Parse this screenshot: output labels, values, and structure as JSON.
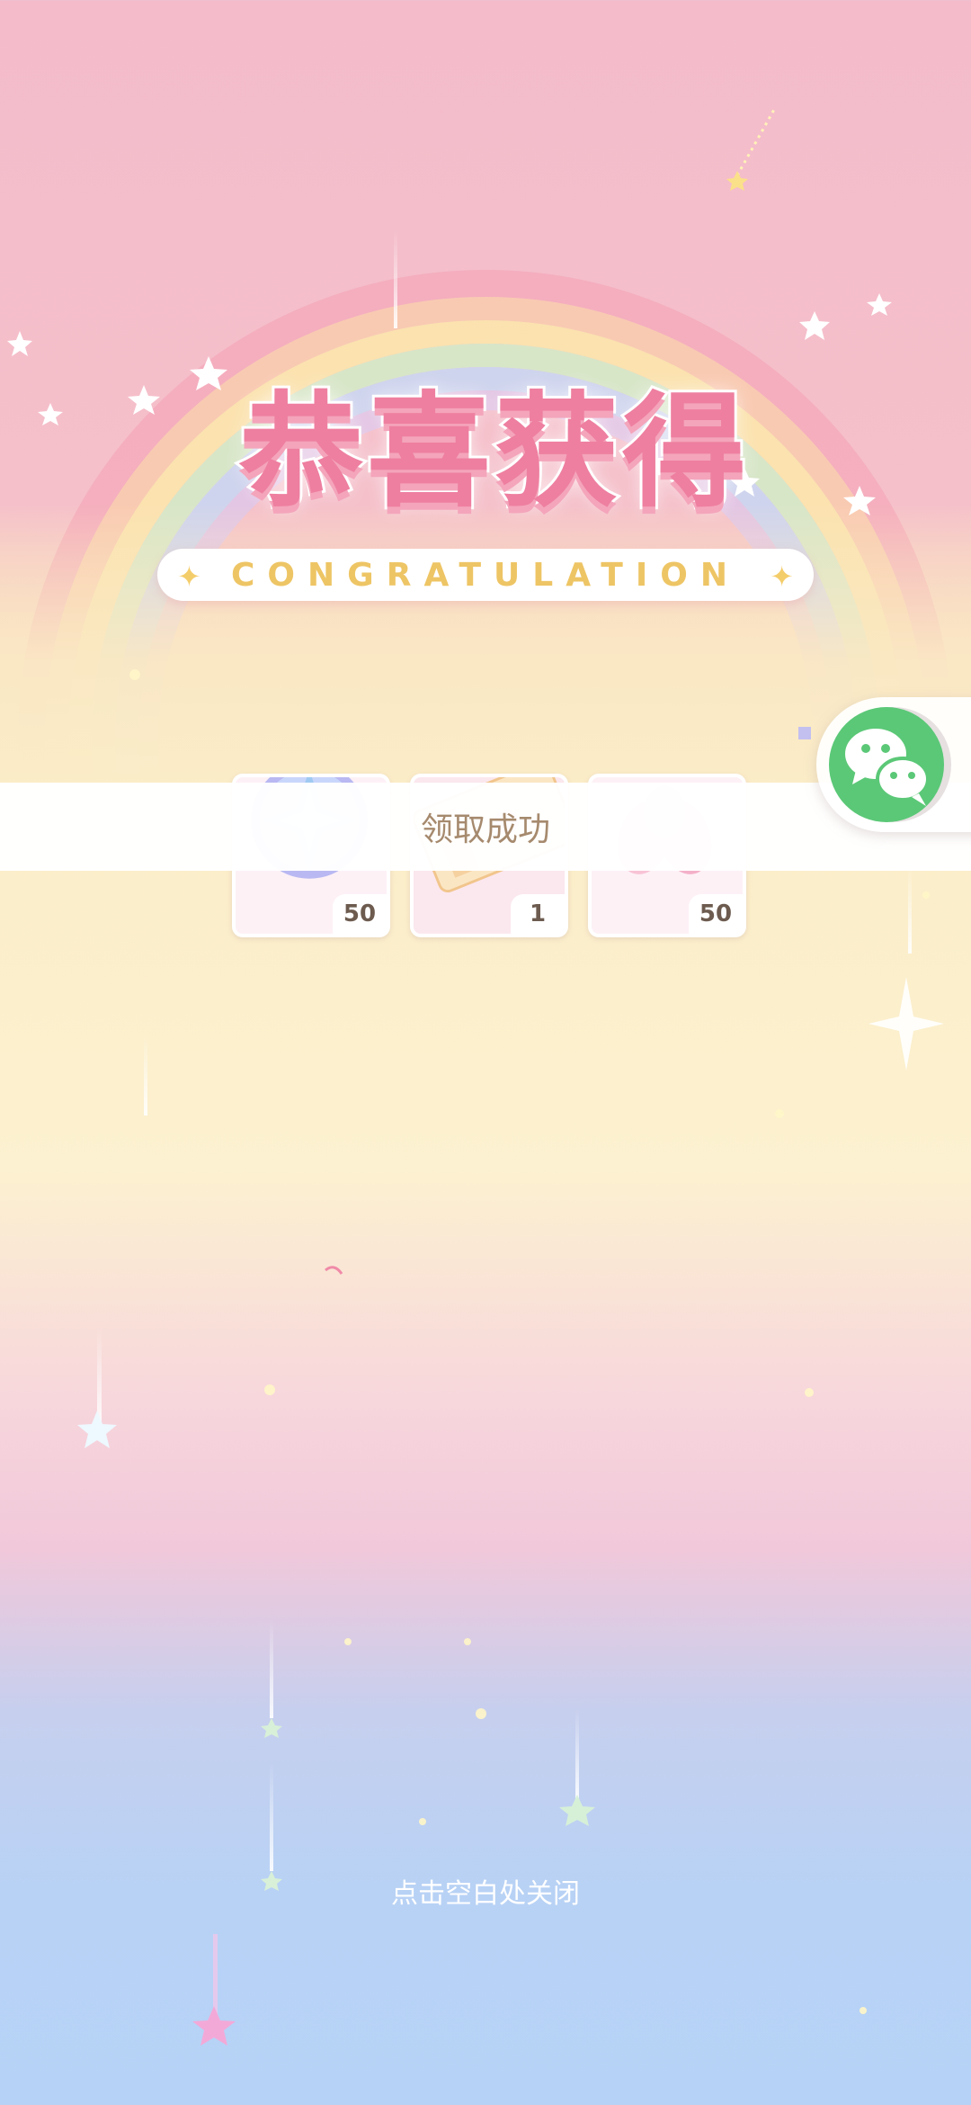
{
  "title": "恭喜获得",
  "subtitle": "CONGRATULATION",
  "rewards": [
    {
      "icon": "star-badge-icon",
      "count": "50"
    },
    {
      "icon": "ticket-icon",
      "count": "1"
    },
    {
      "icon": "sakura-petal-icon",
      "count": "50"
    }
  ],
  "toast": {
    "message": "领取成功"
  },
  "share": {
    "icon": "wechat-icon"
  },
  "close_hint": "点击空白处关闭",
  "colors": {
    "title_pink": "#ee7fa0",
    "subtitle_gold": "#eec565",
    "wechat_green": "#5bc877",
    "toast_text": "#a68a6e"
  }
}
